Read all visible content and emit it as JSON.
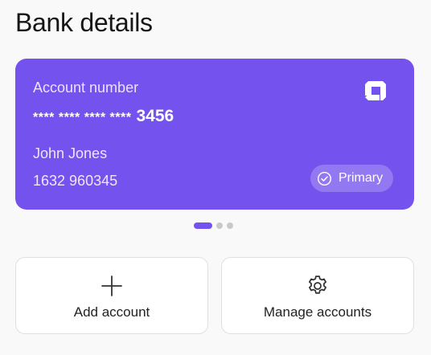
{
  "page": {
    "title": "Bank details"
  },
  "card": {
    "account_label": "Account number",
    "account_mask": "**** **** **** ****",
    "account_last4": "3456",
    "holder_name": "John Jones",
    "sort_and_account": "1632 960345",
    "badge_label": "Primary",
    "badge_icon": "check-circle-icon",
    "bank_logo_icon": "bank-logo-icon",
    "color": "#7452ee"
  },
  "pagination": {
    "total": 3,
    "active_index": 0
  },
  "actions": [
    {
      "label": "Add account",
      "icon": "plus-icon"
    },
    {
      "label": "Manage accounts",
      "icon": "gear-icon"
    }
  ]
}
